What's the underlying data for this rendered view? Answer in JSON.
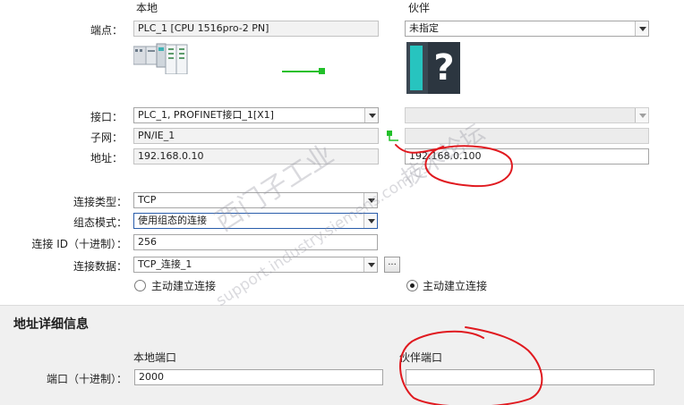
{
  "headers": {
    "local": "本地",
    "partner": "伙伴"
  },
  "endpoint": {
    "label": "端点：",
    "local_value": "PLC_1 [CPU 1516pro-2 PN]",
    "partner_value": "未指定"
  },
  "interface": {
    "label": "接口：",
    "local_value": "PLC_1, PROFINET接口_1[X1]",
    "partner_value": ""
  },
  "subnet": {
    "label": "子网：",
    "local_value": "PN/IE_1",
    "partner_value": ""
  },
  "address": {
    "label": "地址：",
    "local_value": "192.168.0.10",
    "partner_value": "192.168.0.100"
  },
  "connection_type": {
    "label": "连接类型：",
    "value": "TCP"
  },
  "config_mode": {
    "label": "组态模式：",
    "value": "使用组态的连接"
  },
  "connection_id": {
    "label": "连接 ID（十进制）：",
    "value": "256"
  },
  "connection_data": {
    "label": "连接数据：",
    "value": "TCP_连接_1",
    "browse_label": "..."
  },
  "active_connection": {
    "local_label": "主动建立连接",
    "local_selected": false,
    "partner_label": "主动建立连接",
    "partner_selected": true
  },
  "address_details": {
    "title": "地址详细信息",
    "local_port_header": "本地端口",
    "partner_port_header": "伙伴端口",
    "port_label": "端口（十进制）：",
    "local_port": "2000",
    "partner_port": ""
  },
  "watermark": {
    "text1": "西门子工业",
    "text2": "support.industry.siemens.com/cs",
    "text3": "技术论坛"
  },
  "colors": {
    "link_green": "#22c02a",
    "annotation_red": "#e0191f",
    "unknown_device_teal": "#27c4bf",
    "unknown_device_dark": "#3b4752"
  },
  "icons": {
    "local_device": "plc-device-icon",
    "partner_device": "unknown-device-icon"
  }
}
